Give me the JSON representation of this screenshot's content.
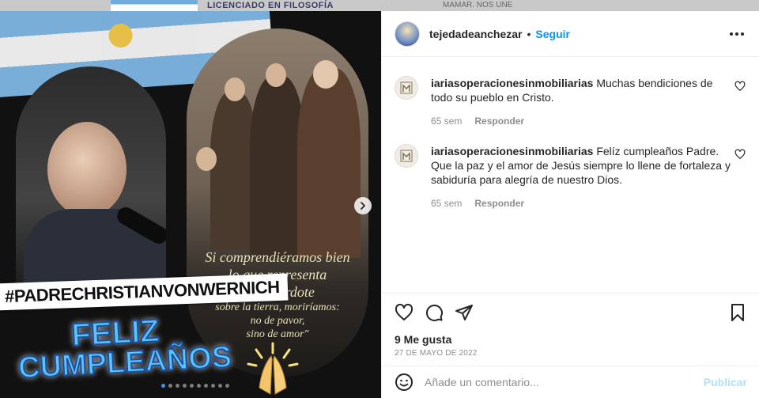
{
  "backdrop": {
    "title": "LICENCIADO EN FILOSOFÍA",
    "title2": "MAMAR. NOS UNE"
  },
  "media": {
    "hashtag": "#PADRECHRISTIANVONWERNICH",
    "greeting_line1": "FELIZ",
    "greeting_line2": "CUMPLEAÑOS",
    "quote_line1": "Si comprendiéramos bien",
    "quote_line2": "lo que representa",
    "quote_line3": "un Sacerdote",
    "quote_line4": "sobre la tierra, moriríamos:",
    "quote_line5": "no de pavor,",
    "quote_line6": "sino de amor\"",
    "next_icon": "chevron-right-icon",
    "carousel_total": 10,
    "carousel_active": 1
  },
  "post": {
    "username": "tejedadeanchezar",
    "separator": "•",
    "follow_label": "Seguir",
    "more_icon": "more-options-icon"
  },
  "comments": [
    {
      "user": "iariasoperacionesinmobiliarias",
      "text": "Muchas bendiciones de todo su pueblo en Cristo.",
      "time": "65 sem",
      "reply": "Responder"
    },
    {
      "user": "iariasoperacionesinmobiliarias",
      "text": "Felíz cumpleaños Padre. Que la paz y el amor de Jesús siempre lo llene de fortaleza y sabiduría para alegría de nuestro Dios.",
      "time": "65 sem",
      "reply": "Responder"
    }
  ],
  "actions": {
    "likes": "9 Me gusta",
    "date": "27 DE MAYO DE 2022"
  },
  "add_comment": {
    "placeholder": "Añade un comentario...",
    "publish_label": "Publicar"
  },
  "colors": {
    "accent": "#0095f6",
    "publish_disabled": "#b2dffc",
    "meta_text": "#8e8e8e"
  }
}
